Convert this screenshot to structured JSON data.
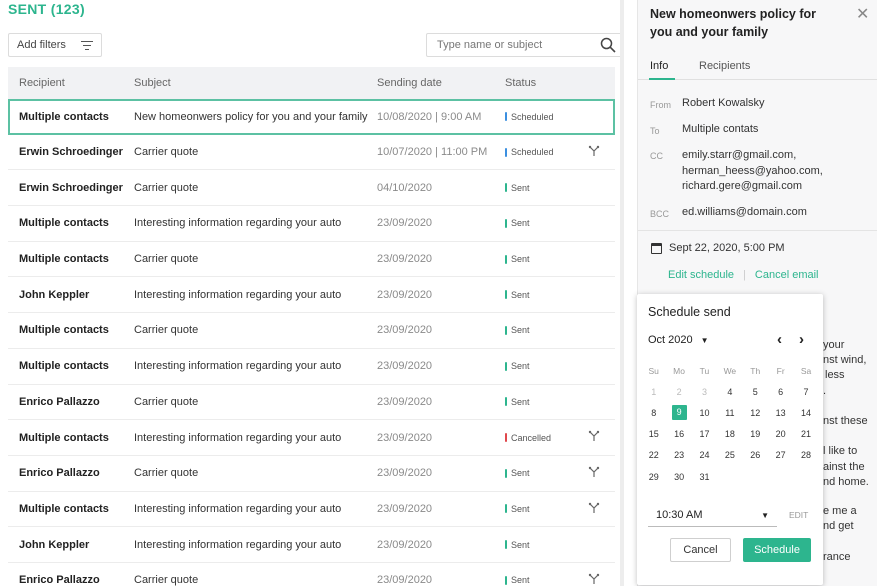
{
  "header": {
    "title": "SENT (123)"
  },
  "toolbar": {
    "filters_label": "Add filters",
    "search_placeholder": "Type name or subject"
  },
  "table": {
    "columns": [
      "Recipient",
      "Subject",
      "Sending date",
      "Status"
    ],
    "rows": [
      {
        "recipient": "Multiple contacts",
        "subject": "New homeonwers policy for you and your family",
        "date": "10/08/2020 | 9:00 AM",
        "status": "Scheduled",
        "status_color": "#3b8fe0",
        "icon": false,
        "selected": true
      },
      {
        "recipient": "Erwin Schroedinger",
        "subject": "Carrier quote",
        "date": "10/07/2020 | 11:00 PM",
        "status": "Scheduled",
        "status_color": "#3b8fe0",
        "icon": true,
        "selected": false
      },
      {
        "recipient": "Erwin Schroedinger",
        "subject": "Carrier quote",
        "date": "04/10/2020",
        "status": "Sent",
        "status_color": "#2db58e",
        "icon": false,
        "selected": false
      },
      {
        "recipient": "Multiple contacts",
        "subject": "Interesting information regarding your auto",
        "date": "23/09/2020",
        "status": "Sent",
        "status_color": "#2db58e",
        "icon": false,
        "selected": false
      },
      {
        "recipient": "Multiple contacts",
        "subject": "Carrier quote",
        "date": "23/09/2020",
        "status": "Sent",
        "status_color": "#2db58e",
        "icon": false,
        "selected": false
      },
      {
        "recipient": "John Keppler",
        "subject": "Interesting information regarding your auto",
        "date": "23/09/2020",
        "status": "Sent",
        "status_color": "#2db58e",
        "icon": false,
        "selected": false
      },
      {
        "recipient": "Multiple contacts",
        "subject": "Carrier quote",
        "date": "23/09/2020",
        "status": "Sent",
        "status_color": "#2db58e",
        "icon": false,
        "selected": false
      },
      {
        "recipient": "Multiple contacts",
        "subject": "Interesting information regarding your auto",
        "date": "23/09/2020",
        "status": "Sent",
        "status_color": "#2db58e",
        "icon": false,
        "selected": false
      },
      {
        "recipient": "Enrico Pallazzo",
        "subject": "Carrier quote",
        "date": "23/09/2020",
        "status": "Sent",
        "status_color": "#2db58e",
        "icon": false,
        "selected": false
      },
      {
        "recipient": "Multiple contacts",
        "subject": "Interesting information regarding your auto",
        "date": "23/09/2020",
        "status": "Cancelled",
        "status_color": "#e0474c",
        "icon": true,
        "selected": false
      },
      {
        "recipient": "Enrico Pallazzo",
        "subject": "Carrier quote",
        "date": "23/09/2020",
        "status": "Sent",
        "status_color": "#2db58e",
        "icon": true,
        "selected": false
      },
      {
        "recipient": "Multiple contacts",
        "subject": "Interesting information regarding your auto",
        "date": "23/09/2020",
        "status": "Sent",
        "status_color": "#2db58e",
        "icon": true,
        "selected": false
      },
      {
        "recipient": "John Keppler",
        "subject": "Interesting information regarding your auto",
        "date": "23/09/2020",
        "status": "Sent",
        "status_color": "#2db58e",
        "icon": false,
        "selected": false
      },
      {
        "recipient": "Enrico Pallazzo",
        "subject": "Carrier quote",
        "date": "23/09/2020",
        "status": "Sent",
        "status_color": "#2db58e",
        "icon": true,
        "selected": false
      }
    ]
  },
  "detail": {
    "title": "New homeonwers policy for you and your family",
    "tabs": [
      "Info",
      "Recipients"
    ],
    "from_label": "From",
    "from": "Robert Kowalsky",
    "to_label": "To",
    "to": "Multiple contats",
    "cc_label": "CC",
    "cc": [
      "emily.starr@gmail.com,",
      "herman_heess@yahoo.com,",
      "richard.gere@gmail.com"
    ],
    "bcc_label": "BCC",
    "bcc": "ed.williams@domain.com",
    "schedule_date": "Sept 22, 2020, 5:00 PM",
    "edit_schedule": "Edit schedule",
    "cancel_email": "Cancel email",
    "body_fragments": [
      "your",
      "nst wind,",
      "less",
      ".",
      "nst these",
      "l like to",
      "ainst the",
      "nd home.",
      "e me a",
      "nd get",
      "rance"
    ]
  },
  "schedule_popup": {
    "title": "Schedule send",
    "month": "Oct 2020",
    "weekdays": [
      "Su",
      "Mo",
      "Tu",
      "We",
      "Th",
      "Fr",
      "Sa"
    ],
    "weeks": [
      [
        "1",
        "2",
        "3",
        "4",
        "5",
        "6",
        "7"
      ],
      [
        "8",
        "9",
        "10",
        "11",
        "12",
        "13",
        "14"
      ],
      [
        "15",
        "16",
        "17",
        "18",
        "19",
        "20",
        "21"
      ],
      [
        "22",
        "23",
        "24",
        "25",
        "26",
        "27",
        "28"
      ],
      [
        "29",
        "30",
        "31",
        "",
        "",
        "",
        ""
      ]
    ],
    "dim_days": [
      "1",
      "2",
      "3"
    ],
    "selected_day": "9",
    "time": "10:30 AM",
    "edit_label": "EDIT",
    "cancel_label": "Cancel",
    "schedule_label": "Schedule"
  },
  "colors": {
    "accent": "#2db58e",
    "scheduled": "#3b8fe0",
    "cancelled": "#e0474c"
  },
  "icons": {
    "filter": "filter-icon",
    "search": "search-icon",
    "close": "close-icon",
    "calendar": "calendar-icon",
    "tracking": "tracking-icon"
  }
}
